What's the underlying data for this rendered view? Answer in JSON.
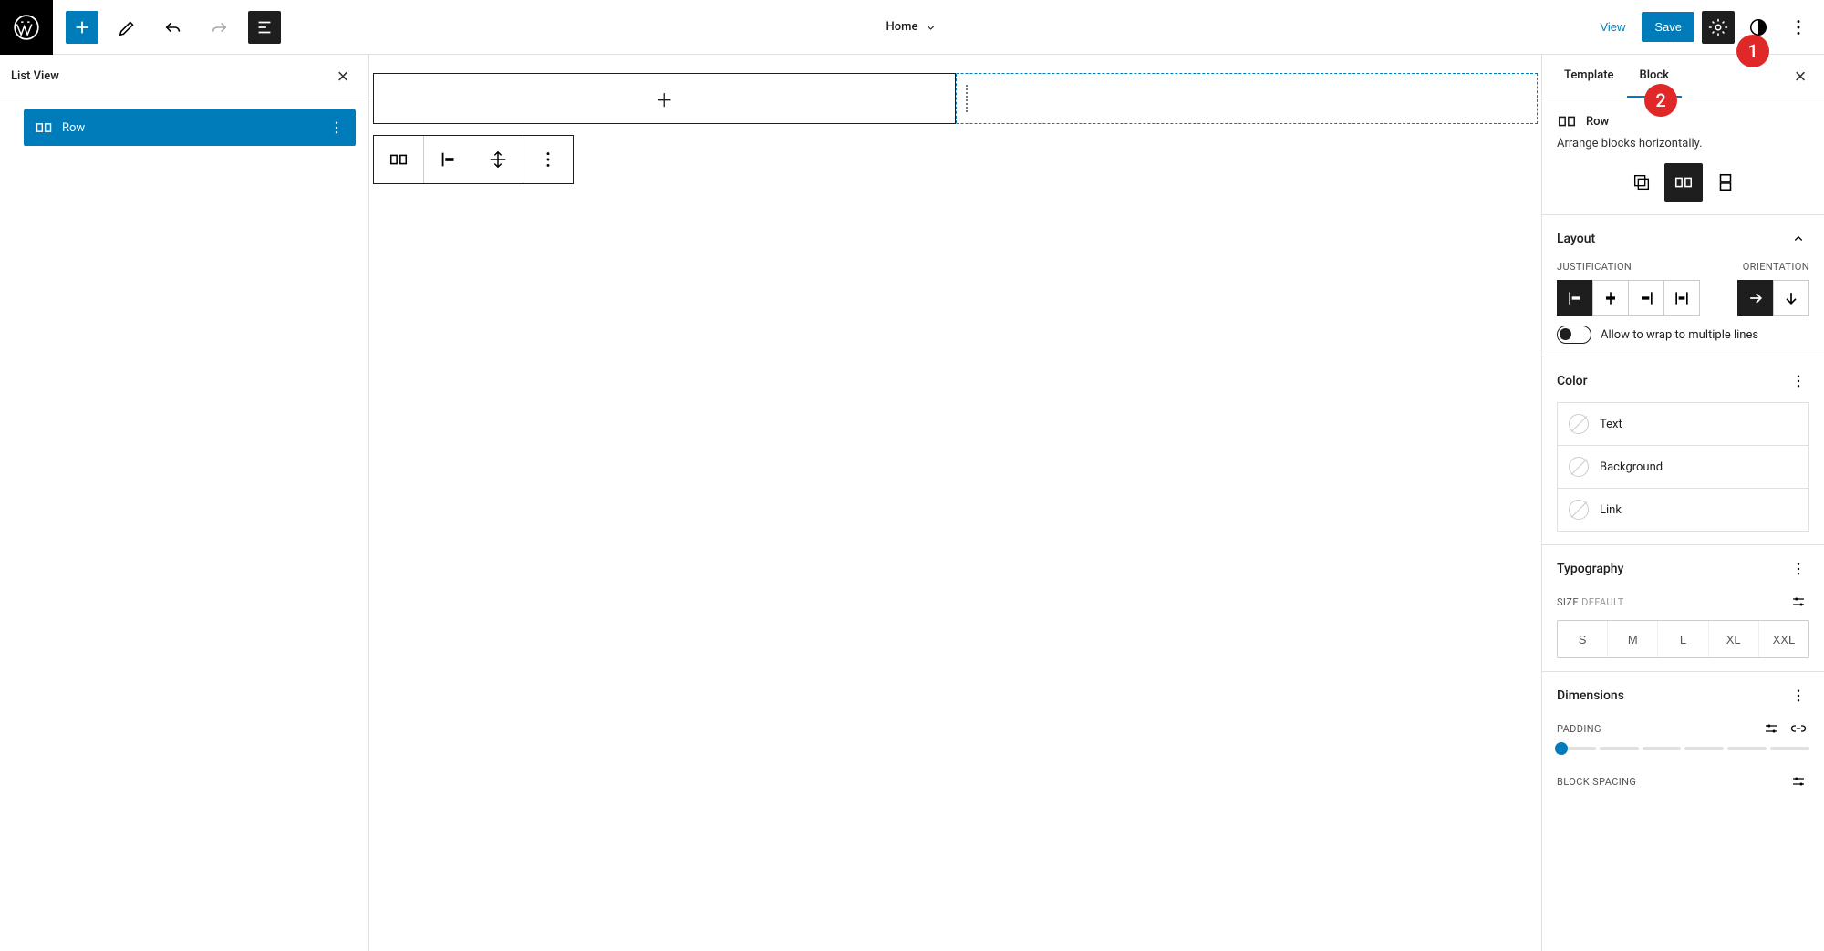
{
  "topbar": {
    "page_title": "Home",
    "view_label": "View",
    "save_label": "Save"
  },
  "listview": {
    "title": "List View",
    "items": [
      {
        "label": "Row"
      }
    ]
  },
  "sidebar": {
    "tabs": {
      "template": "Template",
      "block": "Block"
    },
    "block": {
      "name": "Row",
      "description": "Arrange blocks horizontally."
    },
    "layout": {
      "title": "Layout",
      "justification_label": "Justification",
      "orientation_label": "Orientation",
      "wrap_label": "Allow to wrap to multiple lines"
    },
    "color": {
      "title": "Color",
      "text": "Text",
      "background": "Background",
      "link": "Link"
    },
    "typography": {
      "title": "Typography",
      "size_label": "SIZE",
      "size_default": "DEFAULT",
      "sizes": [
        "S",
        "M",
        "L",
        "XL",
        "XXL"
      ]
    },
    "dimensions": {
      "title": "Dimensions",
      "padding_label": "PADDING",
      "block_spacing_label": "BLOCK SPACING"
    }
  },
  "callouts": {
    "one": "1",
    "two": "2"
  }
}
